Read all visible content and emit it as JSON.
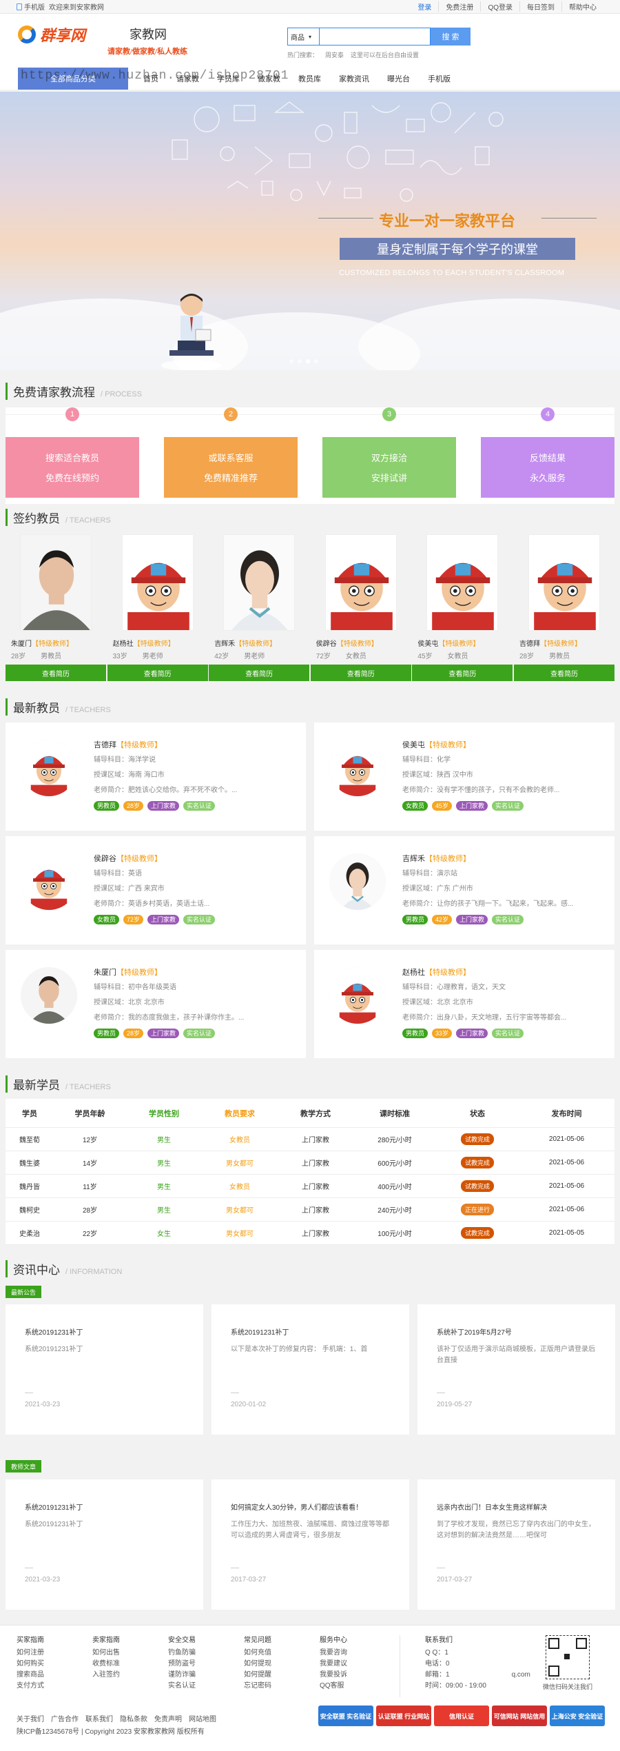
{
  "topbar": {
    "welcome": "欢迎来到安家教网",
    "mobile": "手机版",
    "links": [
      "登录",
      "免费注册",
      "QQ登录",
      "每日签到",
      "帮助中心"
    ]
  },
  "header": {
    "logo_text": "群享网",
    "site_name": "家教网",
    "slogan": "请家教/做家教/私人教练",
    "search_select": "商品",
    "search_placeholder": "",
    "search_button": "搜 索",
    "hot_label": "热门搜索：",
    "hot_items": [
      "周安泰",
      "这里可以在后台自由设置"
    ]
  },
  "watermark": "https://www.huzhan.com/ishop28701",
  "nav": {
    "category": "全部商品分类",
    "items": [
      "首页",
      "请家教",
      "学员库",
      "做家教",
      "教员库",
      "家教资讯",
      "曝光台",
      "手机版"
    ]
  },
  "banner": {
    "title": "专业一对一家教平台",
    "subtitle": "量身定制属于每个学子的课堂",
    "english": "CUSTOMIZED BELONGS TO EACH STUDENT'S CLASSROOM"
  },
  "process": {
    "title": "免费请家教流程",
    "en": "/ PROCESS",
    "steps": [
      {
        "num": "1",
        "line1": "搜索适合教员",
        "line2": "免费在线预约",
        "color": "#f48fa6"
      },
      {
        "num": "2",
        "line1": "或联系客服",
        "line2": "免费精准推荐",
        "color": "#f4a44a"
      },
      {
        "num": "3",
        "line1": "双方接洽",
        "line2": "安排试讲",
        "color": "#8ccf6e"
      },
      {
        "num": "4",
        "line1": "反馈结果",
        "line2": "永久服务",
        "color": "#c38ef0"
      }
    ]
  },
  "signed": {
    "title": "签约教员",
    "en": "/ TEACHERS",
    "button": "查看简历",
    "items": [
      {
        "name": "朱厦门",
        "level": "【特级教师】",
        "age": "28岁",
        "role": "男教员",
        "avatar": "man"
      },
      {
        "name": "赵杨社",
        "level": "【特级教师】",
        "age": "33岁",
        "role": "男老师",
        "avatar": "cartoon"
      },
      {
        "name": "吉辉禾",
        "level": "【特级教师】",
        "age": "42岁",
        "role": "男老师",
        "avatar": "woman"
      },
      {
        "name": "侯辟谷",
        "level": "【特级教师】",
        "age": "72岁",
        "role": "女教员",
        "avatar": "cartoon"
      },
      {
        "name": "侯美屯",
        "level": "【特级教师】",
        "age": "45岁",
        "role": "女教员",
        "avatar": "cartoon"
      },
      {
        "name": "吉德拜",
        "level": "【特级教师】",
        "age": "28岁",
        "role": "男教员",
        "avatar": "cartoon"
      }
    ]
  },
  "latest": {
    "title": "最新教员",
    "en": "/ TEACHERS",
    "items": [
      {
        "name": "吉德拜",
        "level": "【特级教师】",
        "subject": "辅导科目：海洋学说",
        "area": "授课区域：海南 海口市",
        "intro": "老师简介：肥姓该心交给你。弃不死不收个。...",
        "tags": [
          "男教员",
          "28岁",
          "上门家教",
          "实名认证"
        ],
        "avatar": "cartoon"
      },
      {
        "name": "侯美屯",
        "level": "【特级教师】",
        "subject": "辅导科目：化学",
        "area": "授课区域：陕西 汉中市",
        "intro": "老师简介：没有学不懂的孩子，只有不会教的老师...",
        "tags": [
          "女教员",
          "45岁",
          "上门家教",
          "实名认证"
        ],
        "avatar": "cartoon"
      },
      {
        "name": "侯辟谷",
        "level": "【特级教师】",
        "subject": "辅导科目：英语",
        "area": "授课区域：广西 来宾市",
        "intro": "老师简介：英语乡村英语，英语土话...",
        "tags": [
          "女教员",
          "72岁",
          "上门家教",
          "实名认证"
        ],
        "avatar": "cartoon"
      },
      {
        "name": "吉辉禾",
        "level": "【特级教师】",
        "subject": "辅导科目：演示站",
        "area": "授课区域：广东 广州市",
        "intro": "老师简介：让你的孩子飞翔一下。飞起来，飞起来。感...",
        "tags": [
          "男教员",
          "42岁",
          "上门家教",
          "实名认证"
        ],
        "avatar": "woman"
      },
      {
        "name": "朱厦门",
        "level": "【特级教师】",
        "subject": "辅导科目：初中各年级英语",
        "area": "授课区域：北京 北京市",
        "intro": "老师简介：我的态度我做主，孩子补课你作主。...",
        "tags": [
          "男教员",
          "28岁",
          "上门家教",
          "实名认证"
        ],
        "avatar": "man"
      },
      {
        "name": "赵杨社",
        "level": "【特级教师】",
        "subject": "辅导科目：心理教育，语文，天文",
        "area": "授课区域：北京 北京市",
        "intro": "老师简介：出身八卦，天文地理，五行宇宙等等都会...",
        "tags": [
          "男教员",
          "33岁",
          "上门家教",
          "实名认证"
        ],
        "avatar": "cartoon"
      }
    ]
  },
  "students": {
    "title": "最新学员",
    "en": "/ TEACHERS",
    "headers": [
      "学员",
      "学员年龄",
      "学员性别",
      "教员要求",
      "教学方式",
      "课时标准",
      "状态",
      "发布时间"
    ],
    "rows": [
      [
        "魏至荀",
        "12岁",
        "男生",
        "女教员",
        "上门家教",
        "280元/小时",
        "试教完成",
        "2021-05-06"
      ],
      [
        "魏生婆",
        "14岁",
        "男生",
        "男女都可",
        "上门家教",
        "600元/小时",
        "试教完成",
        "2021-05-06"
      ],
      [
        "魏丹皆",
        "11岁",
        "男生",
        "女教员",
        "上门家教",
        "400元/小时",
        "试教完成",
        "2021-05-06"
      ],
      [
        "魏柯史",
        "28岁",
        "男生",
        "男女都可",
        "上门家教",
        "240元/小时",
        "正在进行",
        "2021-05-06"
      ],
      [
        "史柔治",
        "22岁",
        "女生",
        "男女都可",
        "上门家教",
        "100元/小时",
        "试教完成",
        "2021-05-05"
      ]
    ]
  },
  "info": {
    "title": "资讯中心",
    "en": "/ INFORMATION",
    "notice_label": "最新公告",
    "article_label": "教师文章",
    "notices": [
      {
        "title": "系统20191231补丁",
        "body": "系统20191231补丁",
        "date": "2021-03-23"
      },
      {
        "title": "系统20191231补丁",
        "body": "以下是本次补丁的修复内容： 手机端：1、首",
        "date": "2020-01-02"
      },
      {
        "title": "系统补丁2019年5月27号",
        "body": "该补丁仅适用于演示站商城模板，正版用户请登录后台直接",
        "date": "2019-05-27"
      }
    ],
    "articles": [
      {
        "title": "系统20191231补丁",
        "body": "系统20191231补丁",
        "date": "2021-03-23"
      },
      {
        "title": "如何搞定女人30分钟，男人们都应该看看！",
        "body": "工作压力大、加班熬夜、油腻嘴唇、腐蚀过度等等都可以造成的男人肾虚肾亏，很多朋友",
        "date": "2017-03-27"
      },
      {
        "title": "远亲内衣出门！日本女生竟这样解决",
        "body": "到了学校才发现，竟然已忘了穿内衣出门的中女生，这对想到的解决法竟然是……吧保可",
        "date": "2017-03-27"
      }
    ]
  },
  "footer": {
    "columns": [
      {
        "title": "买家指南",
        "items": [
          "如何注册",
          "如何购买",
          "搜索商品",
          "支付方式"
        ]
      },
      {
        "title": "卖家指南",
        "items": [
          "如何出售",
          "收费标准",
          "入驻签约"
        ]
      },
      {
        "title": "安全交易",
        "items": [
          "钓鱼防骗",
          "预防盗号",
          "谨防诈骗",
          "实名认证"
        ]
      },
      {
        "title": "常见问题",
        "items": [
          "如何充值",
          "如何提现",
          "如何提醒",
          "忘记密码"
        ]
      },
      {
        "title": "服务中心",
        "items": [
          "我要咨询",
          "我要建议",
          "我要投诉",
          "QQ客服"
        ]
      }
    ],
    "contact": {
      "title": "联系我们",
      "qq": "Q Q：1",
      "phone": "电话：0",
      "email": "邮箱：1",
      "email_tail": "q.com",
      "hours": "时间：09:00 - 19:00"
    },
    "qr_caption": "微信扫码关注我们",
    "bottom_links": [
      "关于我们",
      "广告合作",
      "联系我们",
      "隐私条款",
      "免责声明",
      "网站地图"
    ],
    "icp": "陕ICP备12345678号 | Copyright 2023 安家教家教网 版权所有",
    "certs": [
      {
        "label": "安全联盟 实名验证",
        "color": "#2d7ad6"
      },
      {
        "label": "认证联盟 行业网站",
        "color": "#d9342b"
      },
      {
        "label": "信用认证",
        "color": "#e63a2e"
      },
      {
        "label": "可信网站 网站信用",
        "color": "#d12f2f"
      },
      {
        "label": "上海公安 安全验证",
        "color": "#2b82d9"
      }
    ]
  }
}
